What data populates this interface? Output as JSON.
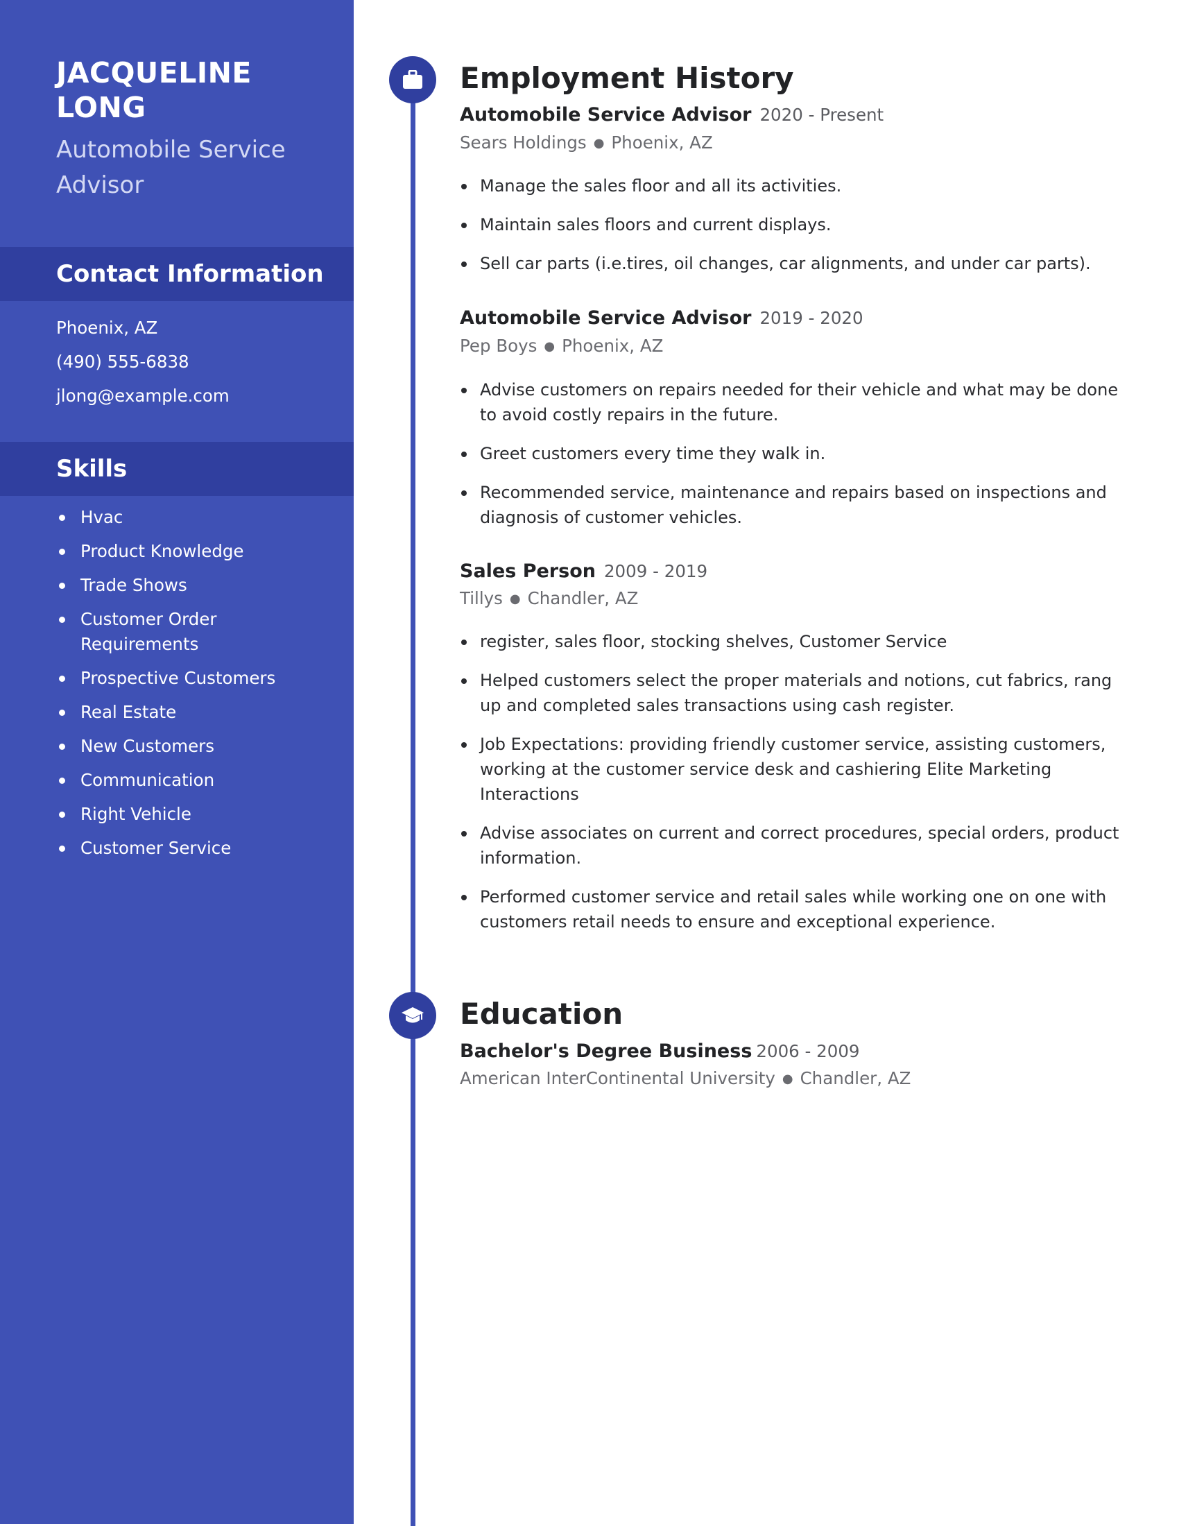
{
  "profile": {
    "name_line1": "JACQUELINE",
    "name_line2": "LONG",
    "role_line1": "Automobile Service",
    "role_line2": "Advisor"
  },
  "contact": {
    "heading": "Contact Information",
    "location": "Phoenix, AZ",
    "phone": "(490) 555-6838",
    "email": "jlong@example.com"
  },
  "skills": {
    "heading": "Skills",
    "items": [
      "Hvac",
      "Product Knowledge",
      "Trade Shows",
      "Customer Order Requirements",
      "Prospective Customers",
      "Real Estate",
      "New Customers",
      "Communication",
      "Right Vehicle",
      "Customer Service"
    ]
  },
  "employment": {
    "heading": "Employment History",
    "icon": "briefcase-icon",
    "jobs": [
      {
        "title": "Automobile Service Advisor",
        "dates": "2020 - Present",
        "company": "Sears Holdings",
        "location": "Phoenix, AZ",
        "bullets": [
          "Manage the sales floor and all its activities.",
          "Maintain sales floors and current displays.",
          "Sell car parts (i.e.tires, oil changes, car alignments, and under car parts)."
        ]
      },
      {
        "title": "Automobile Service Advisor",
        "dates": "2019 - 2020",
        "company": "Pep Boys",
        "location": "Phoenix, AZ",
        "bullets": [
          "Advise customers on repairs needed for their vehicle and what may be done to avoid costly repairs in the future.",
          "Greet customers every time they walk in.",
          "Recommended service, maintenance and repairs based on inspections and diagnosis of customer vehicles."
        ]
      },
      {
        "title": "Sales Person",
        "dates": "2009 - 2019",
        "company": "Tillys",
        "location": "Chandler, AZ",
        "bullets": [
          "register, sales floor, stocking shelves, Customer Service",
          "Helped customers select the proper materials and notions, cut fabrics, rang up and completed sales transactions using cash register.",
          "Job Expectations: providing friendly customer service, assisting customers, working at the customer service desk and cashiering Elite Marketing Interactions",
          "Advise associates on current and correct procedures, special orders, product information.",
          "Performed customer service and retail sales while working one on one with customers retail needs to ensure and exceptional experience."
        ]
      }
    ]
  },
  "education": {
    "heading": "Education",
    "icon": "graduation-cap-icon",
    "degree": "Bachelor's Degree Business",
    "dates": "2006 - 2009",
    "school": "American InterContinental University",
    "location": "Chandler, AZ"
  },
  "colors": {
    "sidebar": "#3f51b5",
    "sidebar_header": "#303f9f",
    "accent": "#3f51b5",
    "text_dark": "#222326",
    "text_muted": "#6a6b70"
  }
}
